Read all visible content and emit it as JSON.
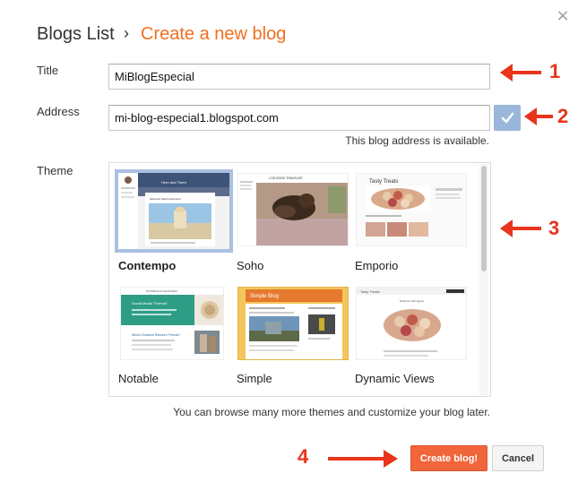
{
  "header": {
    "breadcrumb_parent": "Blogs List",
    "breadcrumb_separator": "›",
    "breadcrumb_current": "Create a new blog",
    "close_glyph": "×"
  },
  "form": {
    "title_label": "Title",
    "title_value": "MiBlogEspecial",
    "address_label": "Address",
    "address_value": "mi-blog-especial1.blogspot.com",
    "availability_message": "This blog address is available.",
    "theme_label": "Theme"
  },
  "themes": [
    {
      "name": "Contempo",
      "selected": true
    },
    {
      "name": "Soho",
      "selected": false
    },
    {
      "name": "Emporio",
      "selected": false
    },
    {
      "name": "Notable",
      "selected": false
    },
    {
      "name": "Simple",
      "selected": false
    },
    {
      "name": "Dynamic Views",
      "selected": false
    }
  ],
  "theme_preview_text": {
    "contempo_hero": "Here and There",
    "contempo_post": "Santorini Island Adventure",
    "soho_header": "LOG BOOK TRAVELER",
    "emporio_header": "Tasty Treats",
    "notable_header": "NOTABLE IN SANTORINI",
    "notable_post": "Social Media \"Friends\"",
    "notable_post2": "What's Distance Between Friends?",
    "simple_header": "Simple Blog",
    "dynamic_header": "Tasty Treats",
    "dynamic_post": "Delicious Meringues"
  },
  "footer": {
    "browse_note": "You can browse many more themes and customize your blog later.",
    "create_button": "Create blog!",
    "cancel_button": "Cancel"
  },
  "annotations": {
    "n1": "1",
    "n2": "2",
    "n3": "3",
    "n4": "4"
  },
  "colors": {
    "accent_orange": "#f07021",
    "create_button": "#f0663a",
    "check_button": "#9ab6da",
    "arrow_red": "#e8351c",
    "selected_border": "#a9c0e1"
  }
}
